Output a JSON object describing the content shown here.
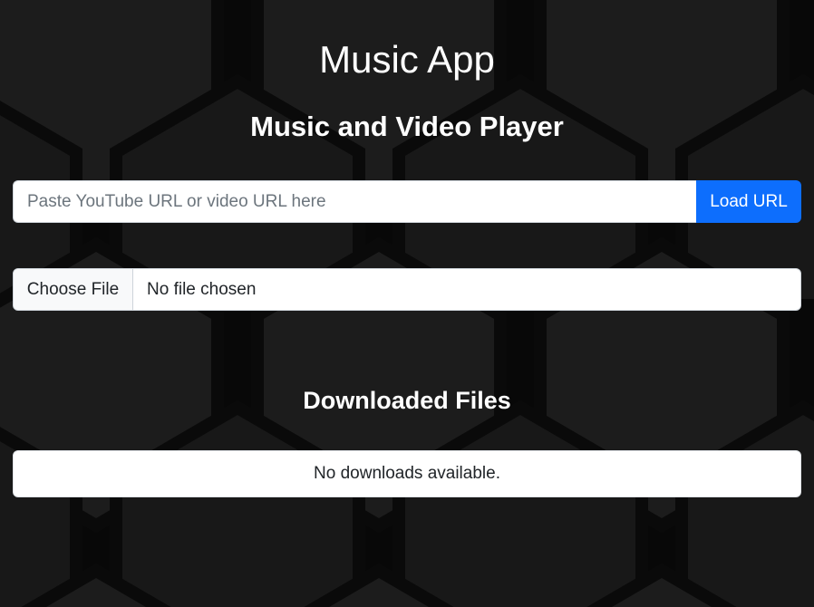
{
  "app": {
    "title": "Music App",
    "subtitle": "Music and Video Player"
  },
  "url_loader": {
    "placeholder": "Paste YouTube URL or video URL here",
    "value": "",
    "button_label": "Load URL"
  },
  "file_picker": {
    "button_label": "Choose File",
    "status": "No file chosen"
  },
  "downloads": {
    "title": "Downloaded Files",
    "empty_message": "No downloads available."
  },
  "colors": {
    "background": "#080808",
    "accent": "#0d6efd",
    "text_on_dark": "#ffffff"
  }
}
